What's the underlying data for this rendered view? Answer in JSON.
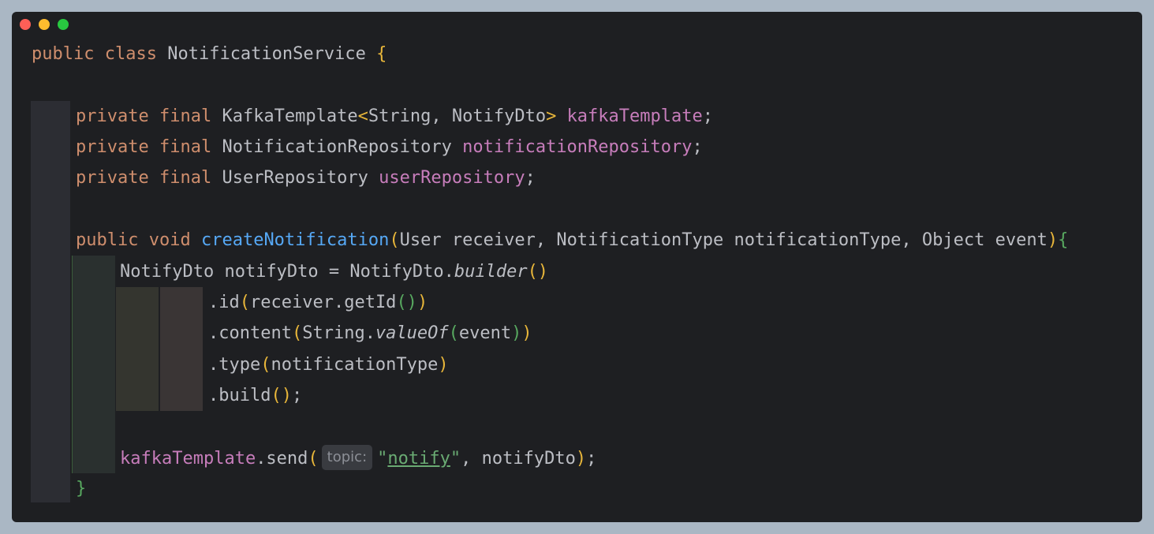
{
  "window": {
    "controls": [
      "close",
      "minimize",
      "maximize"
    ]
  },
  "code": {
    "line1": {
      "kw1": "public",
      "kw2": "class",
      "name": "NotificationService",
      "brace": "{"
    },
    "line2": {
      "kw1": "private",
      "kw2": "final",
      "type": "KafkaTemplate",
      "lt": "<",
      "generic": "String, NotifyDto",
      "gt": ">",
      "field": "kafkaTemplate",
      "semi": ";"
    },
    "line3": {
      "kw1": "private",
      "kw2": "final",
      "type": "NotificationRepository",
      "field": "notificationRepository",
      "semi": ";"
    },
    "line4": {
      "kw1": "private",
      "kw2": "final",
      "type": "UserRepository",
      "field": "userRepository",
      "semi": ";"
    },
    "line5": {
      "kw1": "public",
      "kw2": "void",
      "method": "createNotification",
      "open": "(",
      "params": "User receiver, NotificationType notificationType, Object event",
      "close": ")",
      "brace": "{"
    },
    "line6": {
      "decl": "NotifyDto notifyDto = NotifyDto.",
      "call": "builder",
      "parens": "()"
    },
    "line7": {
      "pre": ".id",
      "open": "(",
      "arg": "receiver.getId",
      "inner": "()",
      "close": ")"
    },
    "line8": {
      "pre": ".content",
      "open": "(",
      "arg": "String.",
      "call": "valueOf",
      "iopen": "(",
      "inner": "event",
      "iclose": ")",
      "close": ")"
    },
    "line9": {
      "pre": ".type",
      "open": "(",
      "arg": "notificationType",
      "close": ")"
    },
    "line10": {
      "pre": ".build",
      "parens": "()",
      "semi": ";"
    },
    "line11": {
      "field": "kafkaTemplate",
      "call": ".send",
      "open": "(",
      "hint": "topic:",
      "q1": "\"",
      "str": "notify",
      "q2": "\"",
      "rest": ", notifyDto",
      "close": ")",
      "semi": ";"
    },
    "line12": {
      "brace": "}"
    }
  }
}
